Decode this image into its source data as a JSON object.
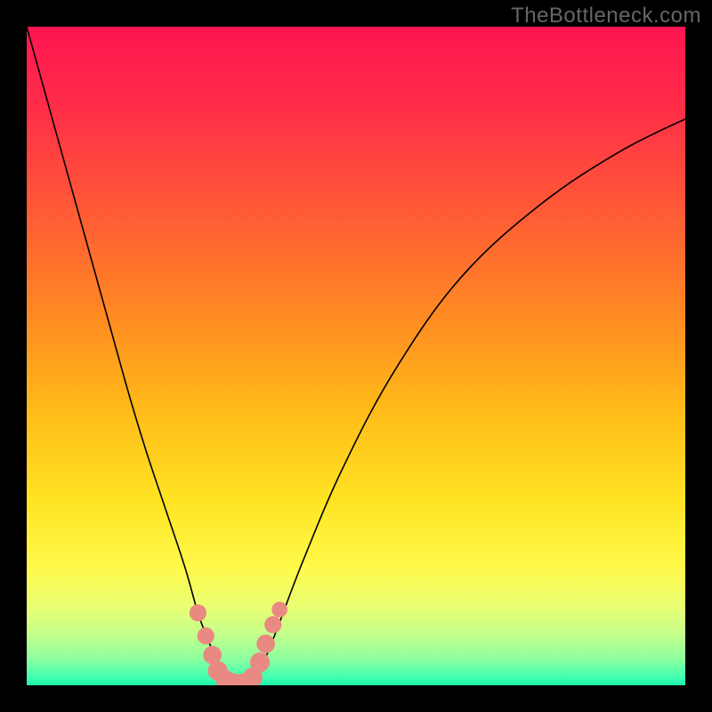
{
  "watermark": "TheBottleneck.com",
  "colors": {
    "frame_bg": "#000000",
    "marker_fill": "#e98a82",
    "curve_stroke": "#000000",
    "gradient_stops": [
      {
        "pct": 0,
        "color": "#ff1550"
      },
      {
        "pct": 12,
        "color": "#ff2d49"
      },
      {
        "pct": 28,
        "color": "#ff5a36"
      },
      {
        "pct": 44,
        "color": "#ff8a22"
      },
      {
        "pct": 58,
        "color": "#ffba18"
      },
      {
        "pct": 72,
        "color": "#ffe423"
      },
      {
        "pct": 82,
        "color": "#fff94a"
      },
      {
        "pct": 88,
        "color": "#eaff72"
      },
      {
        "pct": 92,
        "color": "#c8ff8a"
      },
      {
        "pct": 96,
        "color": "#8dff9e"
      },
      {
        "pct": 99,
        "color": "#3bffb4"
      },
      {
        "pct": 100,
        "color": "#1af0a8"
      }
    ]
  },
  "chart_data": {
    "type": "line",
    "title": "",
    "xlabel": "",
    "ylabel": "",
    "xlim": [
      0,
      100
    ],
    "ylim": [
      0,
      100
    ],
    "series": [
      {
        "name": "bottleneck-curve",
        "x": [
          0,
          5,
          10,
          15,
          18,
          21,
          24,
          26,
          27.5,
          29,
          30.5,
          32,
          33,
          34.5,
          36,
          38,
          42,
          48,
          56,
          66,
          78,
          90,
          100
        ],
        "y": [
          100,
          82,
          64,
          46,
          36,
          27,
          18,
          11,
          7,
          3.5,
          1.2,
          0.2,
          0.2,
          1.0,
          3.6,
          8.5,
          19,
          33,
          48,
          62,
          73,
          81,
          86
        ]
      }
    ],
    "markers": {
      "name": "highlight-points",
      "points": [
        {
          "x": 26.0,
          "y": 11.0,
          "r": 1.3
        },
        {
          "x": 27.2,
          "y": 7.5,
          "r": 1.3
        },
        {
          "x": 28.2,
          "y": 4.6,
          "r": 1.4
        },
        {
          "x": 29.0,
          "y": 2.2,
          "r": 1.5
        },
        {
          "x": 30.2,
          "y": 0.8,
          "r": 1.5
        },
        {
          "x": 31.5,
          "y": 0.3,
          "r": 1.5
        },
        {
          "x": 33.0,
          "y": 0.3,
          "r": 1.5
        },
        {
          "x": 34.3,
          "y": 1.2,
          "r": 1.5
        },
        {
          "x": 35.4,
          "y": 3.5,
          "r": 1.5
        },
        {
          "x": 36.3,
          "y": 6.3,
          "r": 1.4
        },
        {
          "x": 37.4,
          "y": 9.2,
          "r": 1.3
        },
        {
          "x": 38.4,
          "y": 11.5,
          "r": 1.2
        }
      ]
    }
  }
}
